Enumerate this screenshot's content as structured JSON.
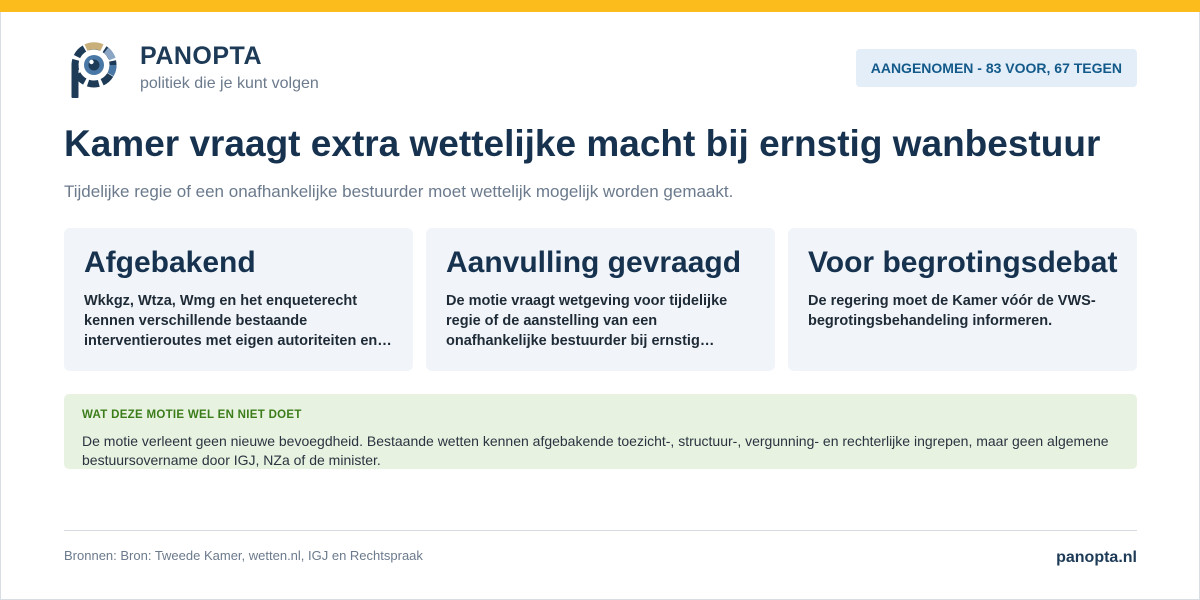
{
  "brand": {
    "name": "PANOPTA",
    "tagline": "politiek die je kunt volgen",
    "logo_icon": "eye-p-logo-icon",
    "colors": {
      "accent": "#fbbc1c",
      "brand": "#1d3a57",
      "iris": "#4a78a6",
      "tan": "#c9b07a"
    }
  },
  "status": {
    "label": "AANGENOMEN - 83 VOOR, 67 TEGEN"
  },
  "headline": {
    "title": "Kamer vraagt extra wettelijke macht bij ernstig wanbestuur",
    "subtitle": "Tijdelijke regie of een onafhankelijke bestuurder moet wettelijk mogelijk worden gemaakt."
  },
  "cards": [
    {
      "title": "Afgebakend",
      "text": "Wkkgz, Wtza, Wmg en het enqueterecht kennen verschillende bestaande interventieroutes met eigen autoriteiten en voorwaarden."
    },
    {
      "title": "Aanvulling gevraagd",
      "text": "De motie vraagt wetgeving voor tijdelijke regie of de aanstelling van een onafhankelijke bestuurder bij ernstig wanbestuur."
    },
    {
      "title": "Voor begrotingsdebat",
      "text": "De regering moet de Kamer vóór de VWS-begrotingsbehandeling informeren."
    }
  ],
  "note": {
    "label": "WAT DEZE MOTIE WEL EN NIET DOET",
    "text": "De motie verleent geen nieuwe bevoegdheid. Bestaande wetten kennen afgebakende toezicht-, structuur-, vergunning- en rechterlijke ingrepen, maar geen algemene bestuursovername door IGJ, NZa of de minister."
  },
  "footer": {
    "sources": "Bronnen: Bron: Tweede Kamer, wetten.nl, IGJ en Rechtspraak",
    "domain": "panopta.nl"
  }
}
